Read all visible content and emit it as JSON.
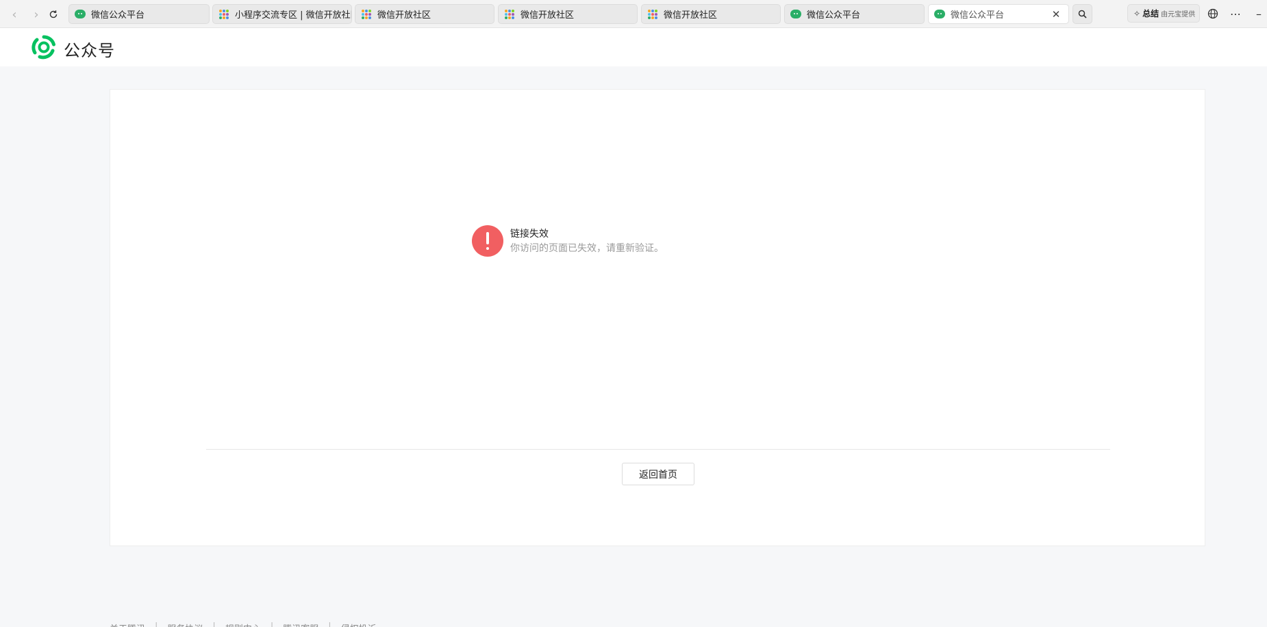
{
  "browser": {
    "tabs": [
      {
        "title": "微信公众平台",
        "icon": "wechat-bubble-icon",
        "active": false
      },
      {
        "title": "小程序交流专区 | 微信开放社区",
        "icon": "dots-grid-icon",
        "active": false
      },
      {
        "title": "微信开放社区",
        "icon": "dots-grid-icon",
        "active": false
      },
      {
        "title": "微信开放社区",
        "icon": "dots-grid-icon",
        "active": false
      },
      {
        "title": "微信开放社区",
        "icon": "dots-grid-icon",
        "active": false
      },
      {
        "title": "微信公众平台",
        "icon": "wechat-bubble-icon",
        "active": false
      },
      {
        "title": "微信公众平台",
        "icon": "wechat-bubble-icon",
        "active": true
      }
    ],
    "summary": {
      "label": "总结",
      "sub": "由元宝提供"
    },
    "colors": {
      "wechat_green": "#2aae67"
    }
  },
  "header": {
    "brand": "公众号",
    "logo_color": "#07c160"
  },
  "error": {
    "title": "链接失效",
    "description": "你访问的页面已失效，请重新验证。",
    "icon_color": "#f15f61",
    "home_button": "返回首页"
  },
  "footer": {
    "links": [
      "关于腾讯",
      "服务协议",
      "规则中心",
      "腾讯客服",
      "侵权投诉"
    ]
  }
}
